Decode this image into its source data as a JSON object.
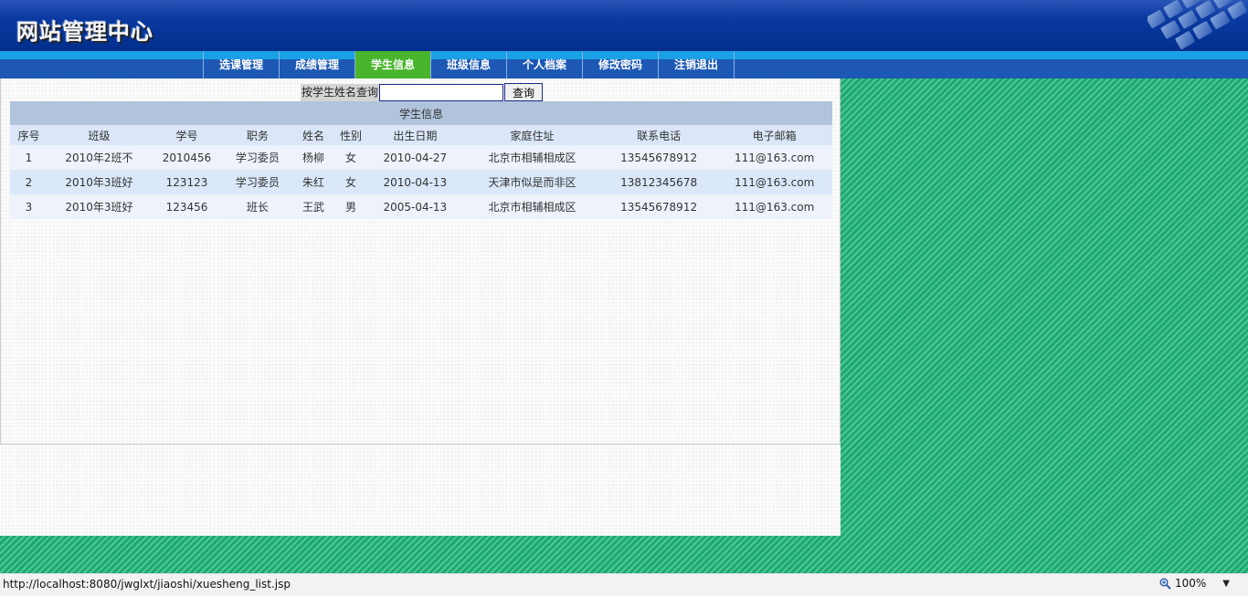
{
  "header": {
    "title": "网站管理中心"
  },
  "nav": {
    "items": [
      {
        "label": "选课管理",
        "active": false
      },
      {
        "label": "成绩管理",
        "active": false
      },
      {
        "label": "学生信息",
        "active": true
      },
      {
        "label": "班级信息",
        "active": false
      },
      {
        "label": "个人档案",
        "active": false
      },
      {
        "label": "修改密码",
        "active": false
      },
      {
        "label": "注销退出",
        "active": false
      }
    ]
  },
  "search": {
    "label": "按学生姓名查询",
    "value": "",
    "button_label": "查询"
  },
  "table": {
    "title": "学生信息",
    "columns": [
      "序号",
      "班级",
      "学号",
      "职务",
      "姓名",
      "性别",
      "出生日期",
      "家庭住址",
      "联系电话",
      "电子邮箱"
    ],
    "rows": [
      [
        "1",
        "2010年2班不",
        "2010456",
        "学习委员",
        "杨柳",
        "女",
        "2010-04-27",
        "北京市相辅相成区",
        "13545678912",
        "111@163.com"
      ],
      [
        "2",
        "2010年3班好",
        "123123",
        "学习委员",
        "朱红",
        "女",
        "2010-04-13",
        "天津市似是而非区",
        "13812345678",
        "111@163.com"
      ],
      [
        "3",
        "2010年3班好",
        "123456",
        "班长",
        "王武",
        "男",
        "2005-04-13",
        "北京市相辅相成区",
        "13545678912",
        "111@163.com"
      ]
    ]
  },
  "status": {
    "url": "http://localhost:8080/jwglxt/jiaoshi/xuesheng_list.jsp",
    "zoom": "100%"
  },
  "colors": {
    "header_blue": "#002f8e",
    "nav_blue": "#1c58b4",
    "nav_active": "#49b52d",
    "background_green": "#1fa870"
  },
  "icons": {
    "zoom": "magnifier-icon",
    "dropdown": "chevron-down-icon"
  }
}
